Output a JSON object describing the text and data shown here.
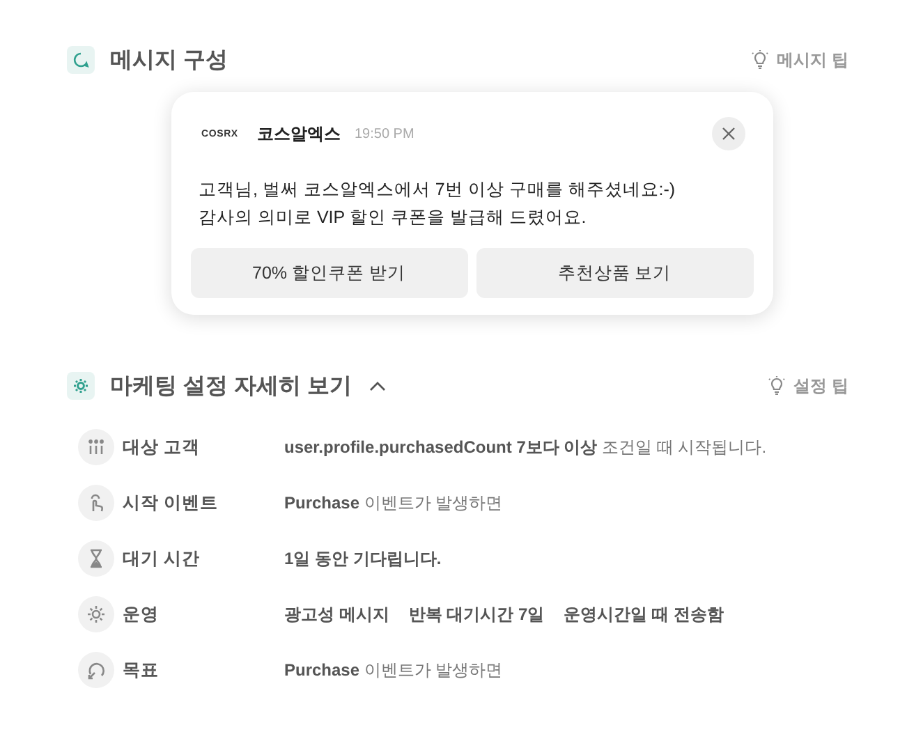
{
  "message_section": {
    "title": "메시지 구성",
    "tip": "메시지 팁"
  },
  "notification": {
    "brand_logo": "COSRX",
    "sender": "코스알엑스",
    "time": "19:50 PM",
    "body": [
      "고객님, 벌써 코스알엑스에서 7번 이상 구매를 해주셨네요:-)",
      "감사의 의미로 VIP 할인 쿠폰을 발급해 드렸어요."
    ],
    "buttons": [
      "70% 할인쿠폰 받기",
      "추천상품 보기"
    ]
  },
  "settings_section": {
    "title": "마케팅 설정 자세히 보기",
    "expanded": true,
    "tip": "설정 팁"
  },
  "settings": [
    {
      "kind": "text",
      "label": "대상 고객",
      "value": "**user.profile.purchasedCount 7보다 이상** 조건일 때 시작됩니다."
    },
    {
      "kind": "text",
      "label": "시작 이벤트",
      "value": "**Purchase** 이벤트가 발생하면"
    },
    {
      "kind": "text",
      "label": "대기 시간",
      "value": "**1일 동안 기다립니다.**"
    },
    {
      "kind": "tags",
      "label": "운영",
      "items": [
        "광고성 메시지",
        "반복 대기시간 7일",
        "운영시간일 때 전송함"
      ]
    },
    {
      "kind": "text",
      "label": "목표",
      "value": "**Purchase** 이벤트가 발생하면"
    }
  ]
}
